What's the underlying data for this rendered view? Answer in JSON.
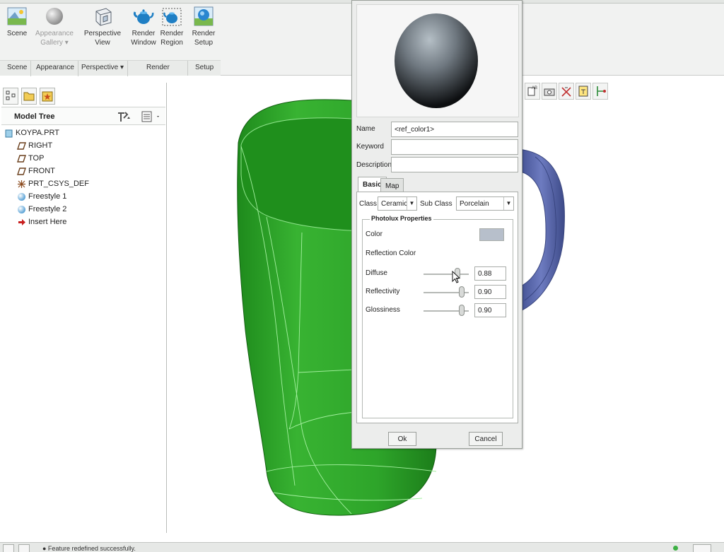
{
  "ribbon": {
    "buttons": [
      {
        "line1": "Scene",
        "line2": ""
      },
      {
        "line1": "Appearance",
        "line2": "Gallery ▾"
      },
      {
        "line1": "Perspective",
        "line2": "View"
      },
      {
        "line1": "Render",
        "line2": "Window"
      },
      {
        "line1": "Render",
        "line2": "Region"
      },
      {
        "line1": "Render",
        "line2": "Setup"
      }
    ],
    "groups": [
      "Scene",
      "Appearance",
      "Perspective ▾",
      "Render",
      "Setup"
    ]
  },
  "model_tree": {
    "title": "Model Tree",
    "items": [
      "KOYPA.PRT",
      "RIGHT",
      "TOP",
      "FRONT",
      "PRT_CSYS_DEF",
      "Freestyle 1",
      "Freestyle 2",
      "Insert Here"
    ]
  },
  "dialog": {
    "name_label": "Name",
    "name_value": "<ref_color1>",
    "keyword_label": "Keyword",
    "keyword_value": "",
    "description_label": "Description",
    "description_value": "",
    "tabs": [
      "Basic",
      "Map"
    ],
    "class_label": "Class",
    "class_value": "Ceramic",
    "subclass_label": "Sub Class",
    "subclass_value": "Porcelain",
    "group_title": "Photolux Properties",
    "color_label": "Color",
    "color_swatch": "#b7bfcb",
    "reflection_color_label": "Reflection Color",
    "diffuse_label": "Diffuse",
    "diffuse_value": "0.88",
    "reflectivity_label": "Reflectivity",
    "reflectivity_value": "0.90",
    "glossiness_label": "Glossiness",
    "glossiness_value": "0.90",
    "ok_label": "Ok",
    "cancel_label": "Cancel"
  },
  "status": {
    "message": "● Feature redefined successfully."
  },
  "colors": {
    "model_green": "#2fa12a",
    "handle_blue": "#5c6aa8"
  }
}
